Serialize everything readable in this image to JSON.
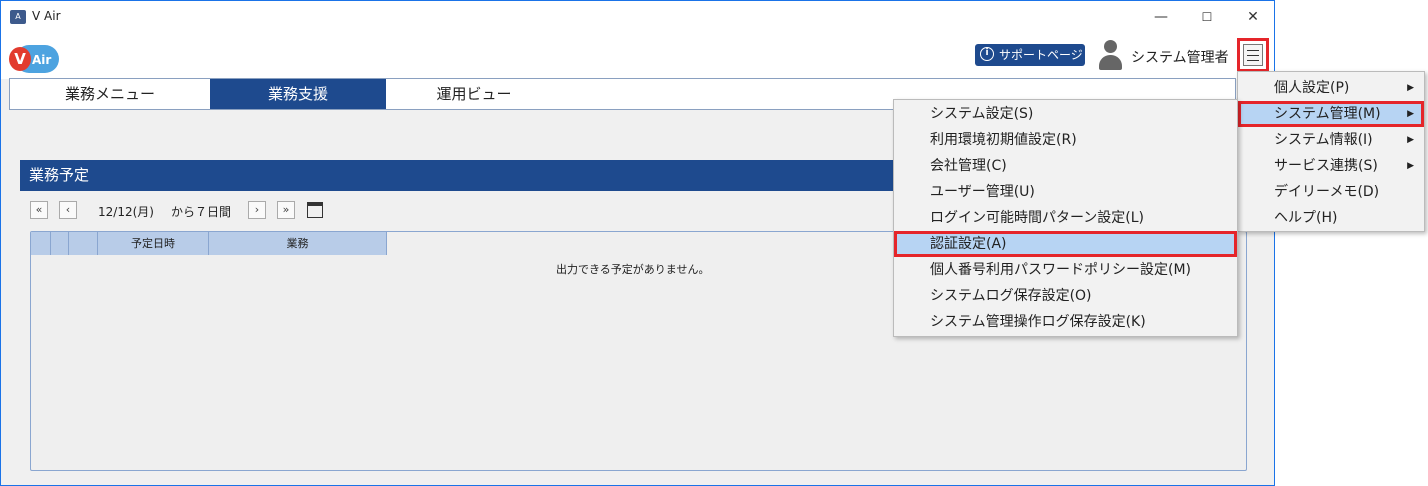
{
  "window": {
    "title": "V Air",
    "minimize": "—",
    "maximize": "☐",
    "close": "✕"
  },
  "header": {
    "logo_v": "V",
    "logo_text": "Air",
    "support_label": "サポートページ",
    "support_icon": "i",
    "user_name": "システム管理者"
  },
  "tabs": [
    {
      "label": "業務メニュー"
    },
    {
      "label": "業務支援"
    },
    {
      "label": "運用ビュー"
    }
  ],
  "panel": {
    "title": "業務予定",
    "nav": {
      "first": "«",
      "prev": "‹",
      "date": "12/12(月)",
      "range": "から７日間",
      "next": "›",
      "last": "»"
    },
    "columns": [
      "",
      "",
      "",
      "予定日時",
      "業務"
    ],
    "empty_message": "出力できる予定がありません。"
  },
  "main_menu": [
    {
      "label": "個人設定(P)",
      "submenu": true
    },
    {
      "label": "システム管理(M)",
      "submenu": true
    },
    {
      "label": "システム情報(I)",
      "submenu": true
    },
    {
      "label": "サービス連携(S)",
      "submenu": true
    },
    {
      "label": "デイリーメモ(D)",
      "submenu": false
    },
    {
      "label": "ヘルプ(H)",
      "submenu": false
    }
  ],
  "sub_menu": [
    {
      "label": "システム設定(S)"
    },
    {
      "label": "利用環境初期値設定(R)"
    },
    {
      "label": "会社管理(C)"
    },
    {
      "label": "ユーザー管理(U)"
    },
    {
      "label": "ログイン可能時間パターン設定(L)"
    },
    {
      "label": "認証設定(A)"
    },
    {
      "label": "個人番号利用パスワードポリシー設定(M)"
    },
    {
      "label": "システムログ保存設定(O)"
    },
    {
      "label": "システム管理操作ログ保存設定(K)"
    }
  ],
  "colors": {
    "accent": "#1e4a8e",
    "highlight": "#b7d4f3",
    "annotation_red": "#e5252a"
  }
}
